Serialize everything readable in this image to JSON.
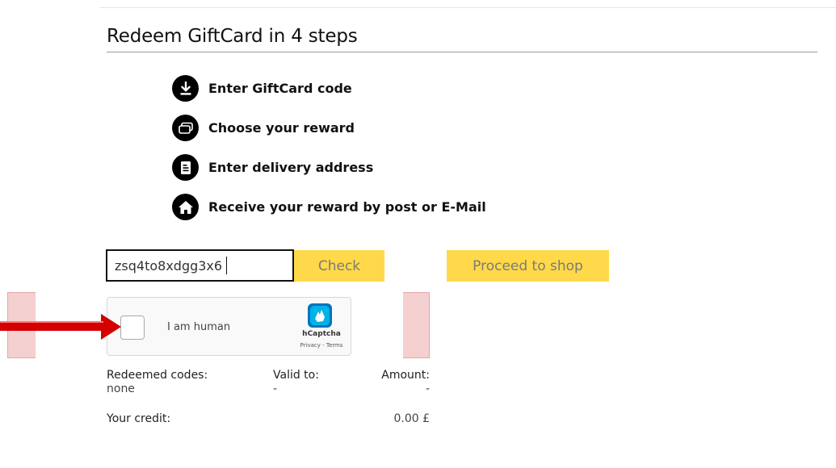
{
  "header": {
    "title": "Redeem GiftCard in 4 steps"
  },
  "steps": [
    {
      "label": "Enter GiftCard code",
      "icon": "download-icon"
    },
    {
      "label": "Choose your reward",
      "icon": "cards-icon"
    },
    {
      "label": "Enter delivery address",
      "icon": "document-icon"
    },
    {
      "label": "Receive your reward by post or E-Mail",
      "icon": "home-icon"
    }
  ],
  "redeem": {
    "code_value": "zsq4to8xdgg3x6",
    "check_label": "Check",
    "proceed_label": "Proceed to shop"
  },
  "captcha": {
    "label": "I am human",
    "brand": "hCaptcha",
    "links": "Privacy - Terms"
  },
  "summary": {
    "redeemed_header": "Redeemed codes:",
    "valid_header": "Valid to:",
    "amount_header": "Amount:",
    "redeemed_value": "none",
    "valid_value": "-",
    "amount_value": "-",
    "credit_label": "Your credit:",
    "credit_value": "0.00 £"
  },
  "colors": {
    "button": "#ffd949",
    "highlight": "#f4d0d0",
    "arrow": "#d40000",
    "hcaptcha": "#0074bf"
  }
}
